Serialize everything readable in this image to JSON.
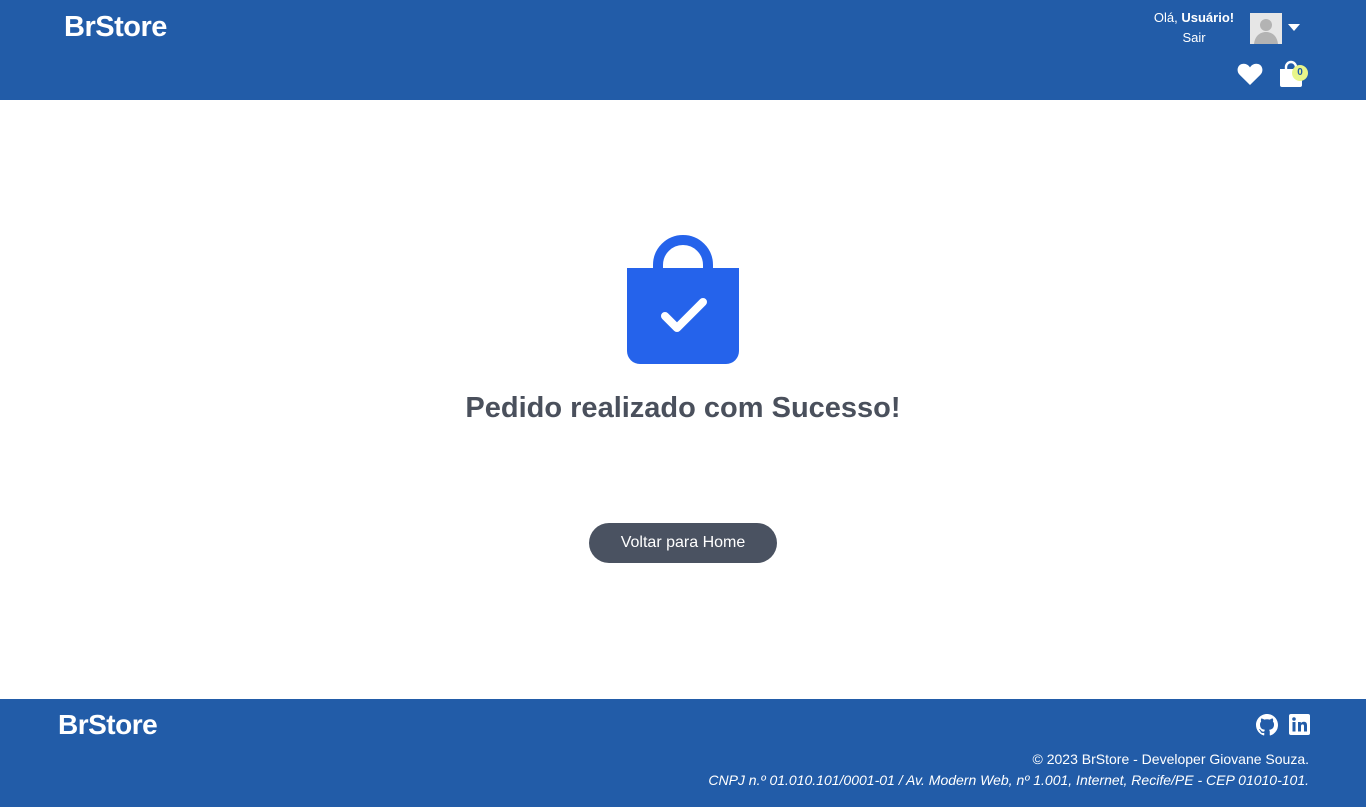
{
  "header": {
    "brand": "BrStore",
    "greeting_prefix": "Olá, ",
    "user_name": "Usuário!",
    "logout_label": "Sair",
    "avatar_icon": "user-avatar-icon",
    "cart_count": "0",
    "icons": [
      "heart-icon",
      "shopping-bag-icon",
      "chevron-down-icon"
    ]
  },
  "main": {
    "icon": "shopping-bag-check-icon",
    "title": "Pedido realizado com Sucesso!",
    "home_button_label": "Voltar para Home"
  },
  "footer": {
    "brand": "BrStore",
    "copyright": "© 2023 BrStore - Developer Giovane Souza.",
    "address": "CNPJ n.º 01.010.101/0001-01 / Av. Modern Web, nº 1.001, Internet, Recife/PE - CEP 01010-101.",
    "icons": [
      "github-icon",
      "linkedin-icon"
    ]
  },
  "colors": {
    "primary": "#225ca8",
    "accent_blue": "#2563eb",
    "button": "#4a5261",
    "title_text": "#4a505c",
    "badge": "#e8f58a"
  }
}
